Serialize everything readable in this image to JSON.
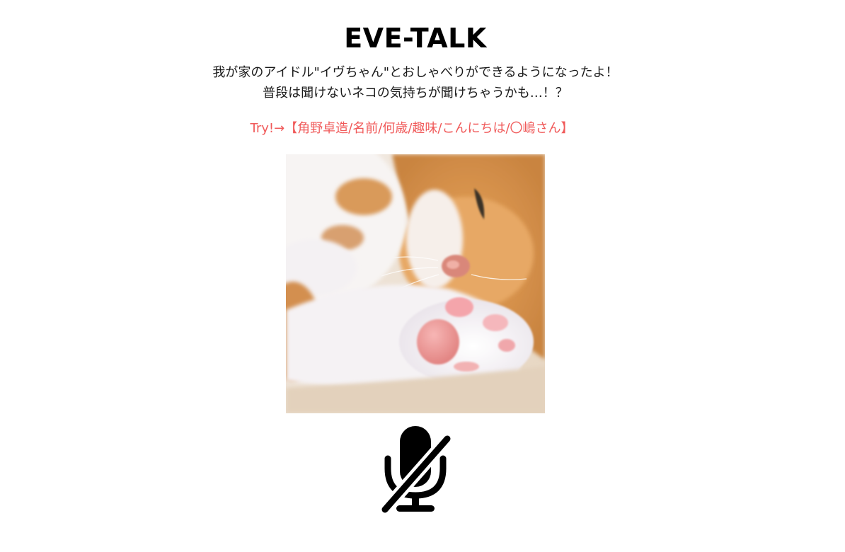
{
  "header": {
    "title": "EVE-TALK"
  },
  "description": {
    "line1": "我が家のアイドル\"イヴちゃん\"とおしゃべりができるようになったよ！",
    "line2": "普段は聞けないネコの気持ちが聞けちゃうかも…！？"
  },
  "try_hint": {
    "text": "Try!→【角野卓造/名前/何歳/趣味/こんにちは/〇嶋さん】",
    "color": "#f05a5a"
  },
  "photo": {
    "subject": "cat-paw-photo"
  },
  "mic": {
    "icon": "microphone-muted-icon",
    "state": "muted",
    "color": "#000000"
  }
}
